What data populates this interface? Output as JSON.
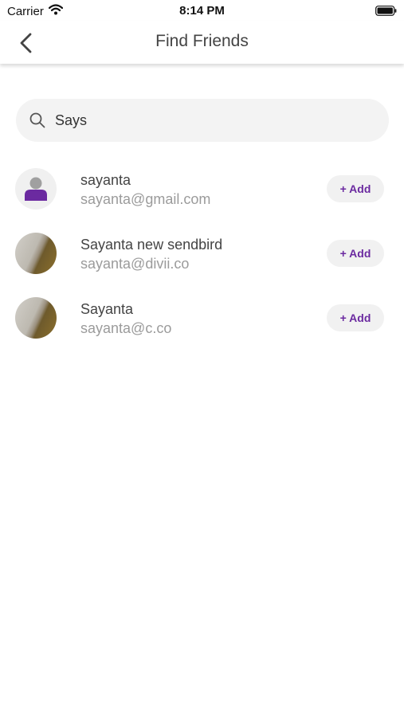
{
  "status_bar": {
    "carrier": "Carrier",
    "time": "8:14 PM"
  },
  "nav": {
    "title": "Find Friends"
  },
  "search": {
    "value": "Says"
  },
  "results": [
    {
      "name": "sayanta",
      "email": "sayanta@gmail.com",
      "avatar": "default-person-icon",
      "add_label": "+ Add"
    },
    {
      "name": "Sayanta new sendbird",
      "email": "sayanta@divii.co",
      "avatar": "photo",
      "add_label": "+ Add"
    },
    {
      "name": "Sayanta",
      "email": "sayanta@c.co",
      "avatar": "photo",
      "add_label": "+ Add"
    }
  ],
  "colors": {
    "accent": "#6b2aa0",
    "add_button_bg": "#f1f1f1",
    "search_bg": "#f3f3f3"
  }
}
